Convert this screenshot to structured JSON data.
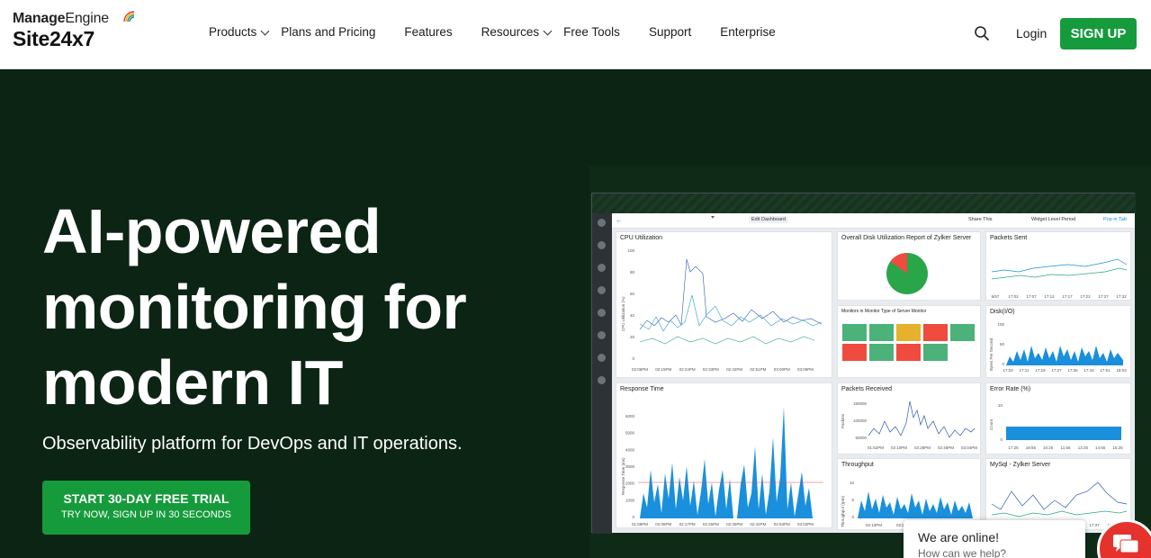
{
  "header": {
    "logo_top_bold": "Manage",
    "logo_top_rest": "Engine",
    "logo_product": "Site24x7",
    "nav": [
      {
        "label": "Products",
        "dropdown": true
      },
      {
        "label": "Plans and Pricing",
        "dropdown": false
      },
      {
        "label": "Features",
        "dropdown": false
      },
      {
        "label": "Resources",
        "dropdown": true
      },
      {
        "label": "Free Tools",
        "dropdown": false
      },
      {
        "label": "Support",
        "dropdown": false
      },
      {
        "label": "Enterprise",
        "dropdown": false
      }
    ],
    "search_icon": "search-icon",
    "login_label": "Login",
    "signup_label": "SIGN UP"
  },
  "hero": {
    "headline_1": "AI-powered",
    "headline_2": "monitoring for",
    "headline_3": "modern IT",
    "subheadline": "Observability platform for DevOps and IT operations.",
    "cta_title": "START 30-DAY FREE TRIAL",
    "cta_subtitle": "TRY NOW, SIGN UP IN 30 SECONDS"
  },
  "dashboard": {
    "edit_label": "Edit Dashboard",
    "share_label": "Share This",
    "period_label": "Widget Level Period",
    "popup_label": "Pop in Tab",
    "widgets": {
      "cpu": "CPU Utilization",
      "disk_util": "Overall Disk Utilization Report of Zylker Server",
      "packets_sent": "Packets Sent",
      "monitors": "Monitors in Monitor Type of Server Monitor",
      "disk_io": "Disk(I/O)",
      "response": "Response Time",
      "packets_received": "Packets Received",
      "error_rate": "Error Rate (%)",
      "throughput": "Throughput",
      "mysql": "MySql - Zylker Server"
    },
    "cpu_y_ticks": [
      "100",
      "80",
      "60",
      "40",
      "20",
      "0"
    ],
    "cpu_x_ticks": [
      "02:06PM",
      "02:15PM",
      "02:24PM",
      "02:33PM",
      "02:42PM",
      "02:51PM",
      "03:00PM",
      "03:09PM"
    ],
    "cpu_ylabel": "CPU Utilization (%)",
    "rt_y_ticks": [
      "6000",
      "5000",
      "4000",
      "3000",
      "2000",
      "1000",
      "0"
    ],
    "rt_x_ticks": [
      "01:58PM",
      "02:08PM",
      "02:17PM",
      "02:26PM",
      "02:35PM",
      "02:44PM",
      "02:53PM",
      "03:02PM"
    ],
    "rt_ylabel": "Response Time (ms)",
    "ps_x_ticks": [
      "6/57",
      "17:02",
      "17:07",
      "17:12",
      "17:17",
      "17:22",
      "17:27",
      "17:32"
    ],
    "dio_y_ticks": [
      "100",
      "50",
      "0"
    ],
    "dio_x_ticks": [
      "17:03",
      "17:11",
      "17:19",
      "17:27",
      "17:35",
      "17:43",
      "17:51",
      "18:03"
    ],
    "dio_ylabel": "Bytes Per Second",
    "pr_y_ticks": [
      "150000",
      "100000",
      "50000"
    ],
    "pr_x_ticks": [
      "01:52PM",
      "02:10PM",
      "02:28PM",
      "02:46PM",
      "03:04PM"
    ],
    "pr_ylabel": "Packets",
    "er_y_ticks": [
      "10",
      "0"
    ],
    "er_x_ticks": [
      "17:25",
      "18:55",
      "10:25",
      "11:55",
      "13:25",
      "14:55",
      "16:25"
    ],
    "er_ylabel": "Count",
    "tp_y_ticks": [
      "10",
      "5",
      "0"
    ],
    "tp_x_ticks": [
      "02:13PM",
      "02:27PM"
    ],
    "tp_ylabel": "Throughput (rpm)",
    "my_x_ticks": [
      "17:37",
      "17:45"
    ],
    "pie_used_fraction": 0.15,
    "status_tiles": [
      "green",
      "green",
      "amber",
      "red",
      "green",
      "red",
      "green",
      "red",
      "green"
    ],
    "colors": {
      "accent": "#169b3c",
      "hero_bg": "#0c2414",
      "series_blue": "#1a8fdc",
      "series_teal": "#2aa98a",
      "status_red": "#ef4b3f",
      "status_green": "#4cb27a",
      "status_amber": "#e6b22d"
    }
  },
  "chat": {
    "title": "We are online!",
    "subtitle": "How can we help?"
  }
}
